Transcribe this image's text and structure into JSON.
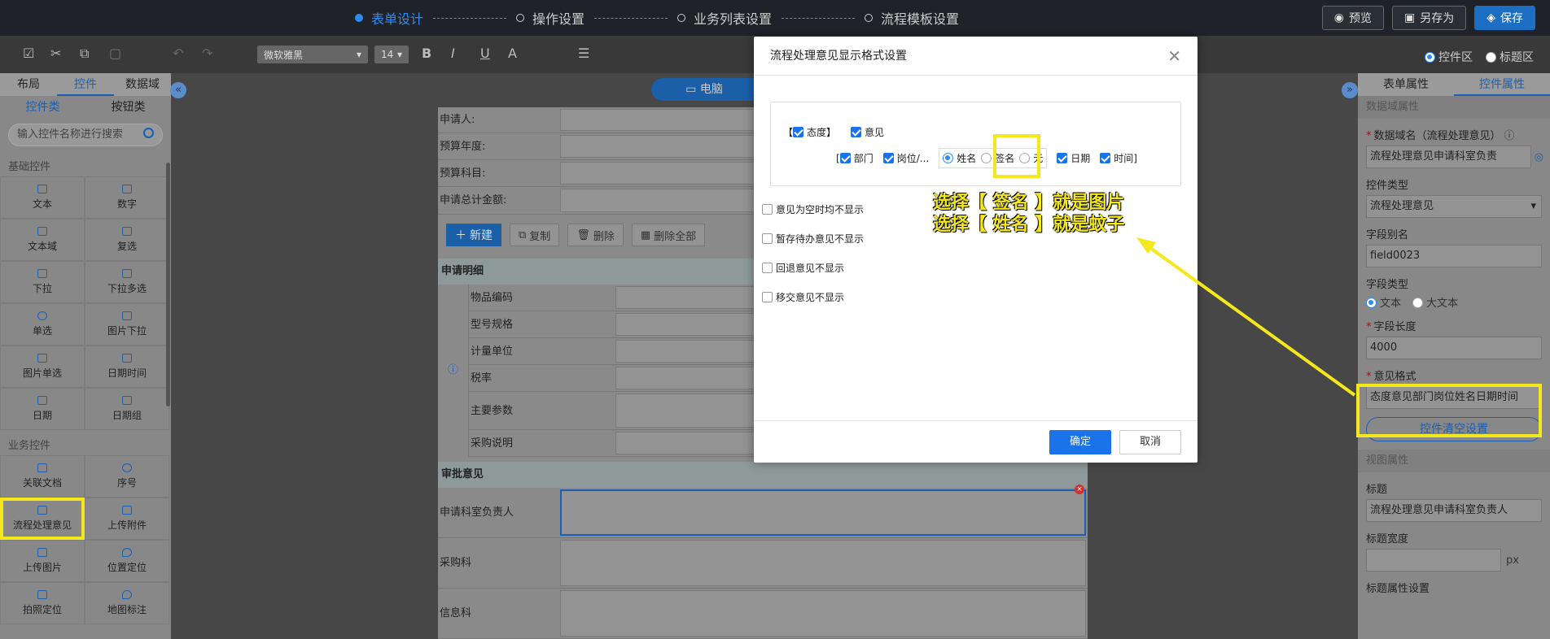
{
  "topbar": {
    "steps": [
      {
        "label": "表单设计",
        "active": true
      },
      {
        "label": "操作设置",
        "active": false
      },
      {
        "label": "业务列表设置",
        "active": false
      },
      {
        "label": "流程模板设置",
        "active": false
      }
    ],
    "preview": "预览",
    "save_as": "另存为",
    "save": "保存"
  },
  "toolbar": {
    "font": "微软雅黑",
    "size": "14",
    "bold": "B",
    "italic": "I",
    "underline": "U",
    "color": "A",
    "control_area": "控件区",
    "title_area": "标题区"
  },
  "left": {
    "tabs": [
      "布局",
      "控件",
      "数据域"
    ],
    "subtabs": [
      "控件类",
      "按钮类"
    ],
    "search_placeholder": "输入控件名称进行搜索",
    "group_basic": "基础控件",
    "basic": [
      "文本",
      "数字",
      "文本域",
      "复选",
      "下拉",
      "下拉多选",
      "单选",
      "图片下拉",
      "图片单选",
      "日期时间",
      "日期",
      "日期组"
    ],
    "group_biz": "业务控件",
    "biz": [
      "关联文档",
      "序号",
      "流程处理意见",
      "上传附件",
      "上传图片",
      "位置定位",
      "拍照定位",
      "地图标注"
    ]
  },
  "canvas": {
    "device": "电脑",
    "rows": [
      "申请人:",
      "预算年度:",
      "预算科目:",
      "申请总计金额:"
    ],
    "sub_buttons": [
      "新建",
      "复制",
      "删除",
      "删除全部"
    ],
    "detail_title": "申请明细",
    "detail_rows": [
      "物品编码",
      "型号规格",
      "计量单位",
      "税率",
      "主要参数",
      "采购说明"
    ],
    "approval_title": "审批意见",
    "approval_rows": [
      "申请科室负责人",
      "采购科",
      "信息科"
    ]
  },
  "right": {
    "tabs": [
      "表单属性",
      "控件属性"
    ],
    "sec_data": "数据域属性",
    "data_name_label": "数据域名（流程处理意见）",
    "data_name_value": "流程处理意见申请科室负责",
    "ctrl_type_label": "控件类型",
    "ctrl_type_value": "流程处理意见",
    "alias_label": "字段别名",
    "alias_value": "field0023",
    "field_type_label": "字段类型",
    "field_type_opts": [
      "文本",
      "大文本"
    ],
    "length_label": "字段长度",
    "length_value": "4000",
    "format_label": "意见格式",
    "format_value": "态度意见部门岗位姓名日期时间",
    "clear_btn": "控件清空设置",
    "sec_view": "视图属性",
    "title_label": "标题",
    "title_value": "流程处理意见申请科室负责人",
    "title_width_label": "标题宽度",
    "px": "px",
    "title_prop_label": "标题属性设置"
  },
  "modal": {
    "title": "流程处理意见显示格式设置",
    "attitude": "态度",
    "opinion": "意见",
    "dept": "部门",
    "post": "岗位/...",
    "name": "姓名",
    "sign": "签名",
    "none": "无",
    "date": "日期",
    "time": "时间",
    "options": [
      "意见为空时均不显示",
      "暂存待办意见不显示",
      "回退意见不显示",
      "移交意见不显示"
    ],
    "ok": "确定",
    "cancel": "取消"
  },
  "annotation": {
    "line1": "选择【 签名 】就是图片",
    "line2": "选择【 姓名 】就是蚊子"
  },
  "colors": {
    "accent": "#1a73e8",
    "highlight": "#f4e81c",
    "topbar": "#1f2329"
  }
}
